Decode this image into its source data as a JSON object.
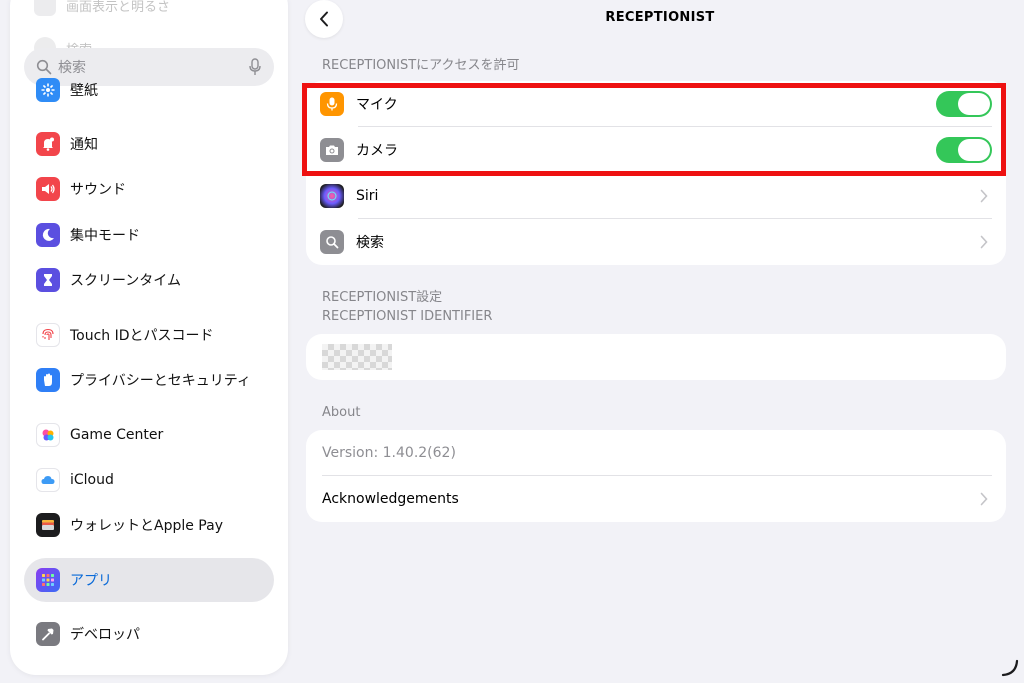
{
  "sidebar": {
    "faded_top": "画面表示と明るさ",
    "faded_search": "検索",
    "search_placeholder": "検索",
    "items": [
      {
        "label": "壁紙",
        "icon": "wallpaper-icon",
        "color": "#2f8cf6"
      },
      {
        "label": "通知",
        "icon": "bell-icon",
        "color": "#f2454b"
      },
      {
        "label": "サウンド",
        "icon": "speaker-icon",
        "color": "#f2454b"
      },
      {
        "label": "集中モード",
        "icon": "moon-icon",
        "color": "#5b4fe0"
      },
      {
        "label": "スクリーンタイム",
        "icon": "hourglass-icon",
        "color": "#5b4fe0"
      },
      {
        "label": "Touch IDとパスコード",
        "icon": "fingerprint-icon",
        "color": "#ffffff"
      },
      {
        "label": "プライバシーとセキュリティ",
        "icon": "hand-icon",
        "color": "#2f7ff6"
      },
      {
        "label": "Game Center",
        "icon": "game-center-icon",
        "color": "#ffffff"
      },
      {
        "label": "iCloud",
        "icon": "cloud-icon",
        "color": "#ffffff"
      },
      {
        "label": "ウォレットとApple Pay",
        "icon": "wallet-icon",
        "color": "#1c1c1e"
      },
      {
        "label": "アプリ",
        "icon": "apps-grid-icon",
        "color": "#6a4df0",
        "selected": true
      },
      {
        "label": "デベロッパ",
        "icon": "hammer-icon",
        "color": "#7a7a80"
      }
    ]
  },
  "nav": {
    "title": "RECEPTIONIST"
  },
  "access": {
    "header": "RECEPTIONISTにアクセスを許可",
    "rows": [
      {
        "label": "マイク",
        "icon": "microphone-icon",
        "color": "#ff9500",
        "toggle": true
      },
      {
        "label": "カメラ",
        "icon": "camera-icon",
        "color": "#8e8e93",
        "toggle": true
      },
      {
        "label": "Siri",
        "icon": "siri-icon",
        "color": "#1c1c1e"
      },
      {
        "label": "検索",
        "icon": "search-icon",
        "color": "#8e8e93"
      }
    ]
  },
  "settings": {
    "header_line1": "RECEPTIONIST設定",
    "header_line2": "RECEPTIONIST IDENTIFIER"
  },
  "about": {
    "header": "About",
    "version": "Version: 1.40.2(62)",
    "acknowledgements": "Acknowledgements"
  },
  "colors": {
    "toggle_on": "#34c759",
    "highlight": "#ee1111",
    "selected_text": "#0a6ad8"
  }
}
